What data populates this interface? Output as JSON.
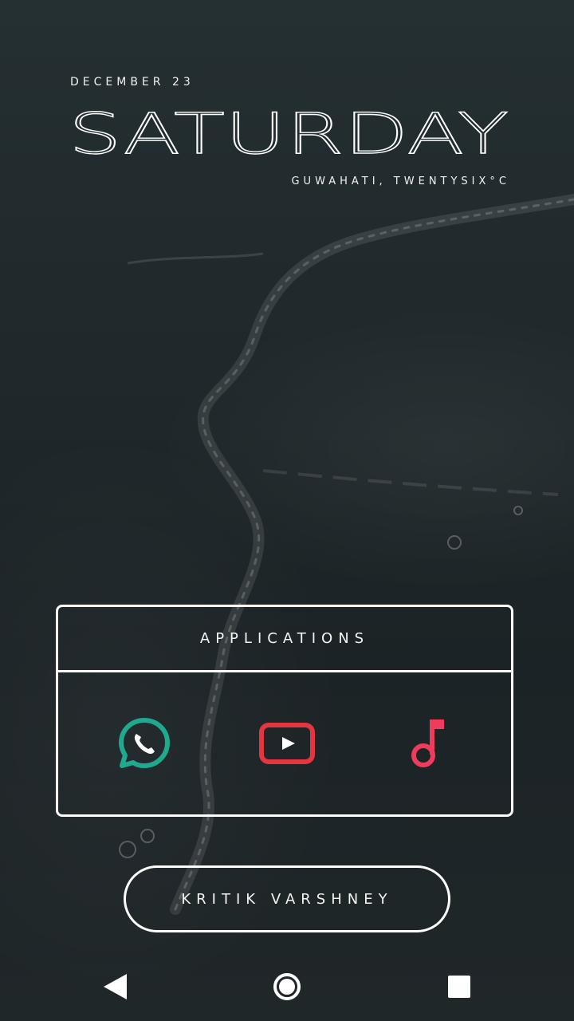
{
  "header": {
    "date": "DECEMBER 23",
    "day": "SATURDAY",
    "weather": "GUWAHATI, TWENTYSIX°C"
  },
  "apps": {
    "title": "APPLICATIONS",
    "items": [
      {
        "icon": "whatsapp-icon",
        "color": "#1fa98f"
      },
      {
        "icon": "youtube-icon",
        "color": "#e5363f"
      },
      {
        "icon": "music-note-icon",
        "color": "#f03c5c"
      }
    ]
  },
  "profile": {
    "name": "KRITIK VARSHNEY"
  },
  "navbar": {
    "items": [
      {
        "icon": "back-triangle-icon"
      },
      {
        "icon": "home-circle-icon"
      },
      {
        "icon": "recents-square-icon"
      }
    ]
  },
  "colors": {
    "outline": "#ffffff",
    "whatsapp": "#1fa98f",
    "youtube": "#e5363f",
    "music": "#f03c5c"
  }
}
